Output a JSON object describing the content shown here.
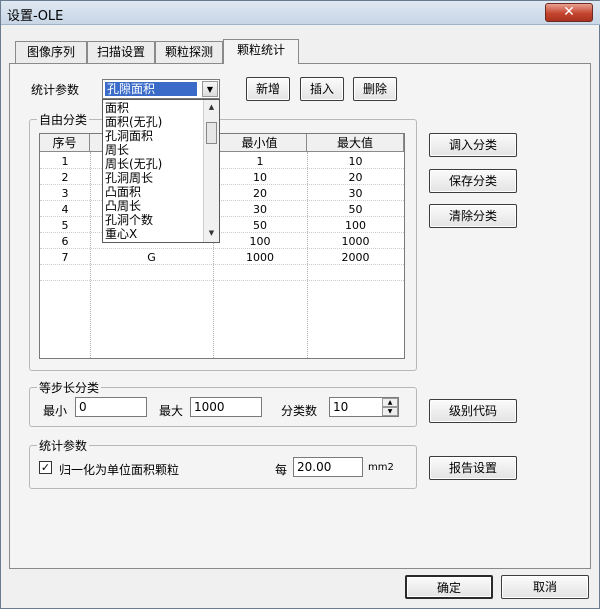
{
  "window": {
    "title": "设置-OLE",
    "close_glyph": "✕"
  },
  "tabs": [
    {
      "label": "图像序列"
    },
    {
      "label": "扫描设置"
    },
    {
      "label": "颗粒探测"
    },
    {
      "label": "颗粒统计"
    }
  ],
  "stat_param": {
    "label": "统计参数",
    "selected": "孔隙面积"
  },
  "toolbar": {
    "add": "新增",
    "insert": "插入",
    "delete": "删除"
  },
  "free_group": {
    "title": "自由分类",
    "columns": [
      "序号",
      "",
      "最小值",
      "最大值"
    ],
    "rows": [
      {
        "index": "1",
        "name": "",
        "min": "1",
        "max": "10"
      },
      {
        "index": "2",
        "name": "",
        "min": "10",
        "max": "20"
      },
      {
        "index": "3",
        "name": "",
        "min": "20",
        "max": "30"
      },
      {
        "index": "4",
        "name": "",
        "min": "30",
        "max": "50"
      },
      {
        "index": "5",
        "name": "",
        "min": "50",
        "max": "100"
      },
      {
        "index": "6",
        "name": "",
        "min": "100",
        "max": "1000"
      },
      {
        "index": "7",
        "name": "G",
        "min": "1000",
        "max": "2000"
      }
    ]
  },
  "dropdown_options": [
    "面积",
    "面积(无孔)",
    "孔洞面积",
    "周长",
    "周长(无孔)",
    "孔洞周长",
    "凸面积",
    "凸周长",
    "孔洞个数",
    "重心X"
  ],
  "right_buttons": {
    "load": "调入分类",
    "save": "保存分类",
    "clear": "清除分类",
    "level_code": "级别代码",
    "report": "报告设置"
  },
  "step_group": {
    "title": "等步长分类",
    "min_label": "最小",
    "min_value": "0",
    "max_label": "最大",
    "max_value": "1000",
    "count_label": "分类数",
    "count_value": "10"
  },
  "stat_group": {
    "title": "统计参数",
    "normalize_label": "归一化为单位面积颗粒",
    "normalize_checked": "✓",
    "per_label": "每",
    "per_value": "20.00",
    "unit": "mm2"
  },
  "footer": {
    "ok": "确定",
    "cancel": "取消"
  }
}
